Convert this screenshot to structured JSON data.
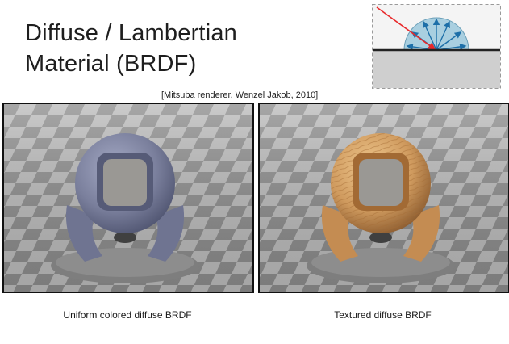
{
  "slide": {
    "title_line1": "Diffuse / Lambertian",
    "title_line2": "Material (BRDF)",
    "citation": "[Mitsuba renderer, Wenzel Jakob, 2010]"
  },
  "renders": [
    {
      "caption": "Uniform colored diffuse BRDF",
      "material": "uniform-blue-gray"
    },
    {
      "caption": "Textured diffuse BRDF",
      "material": "wood-texture"
    }
  ],
  "colors": {
    "incident_ray": "#e8282a",
    "reflected_rays": "#1d6fa8",
    "hemisphere_fill": "#a9cfe0",
    "surface_line": "#222222",
    "ground_fill": "#cfcfcf",
    "uniform_material": "#8288a6",
    "wood_material": "#d8a86c"
  }
}
